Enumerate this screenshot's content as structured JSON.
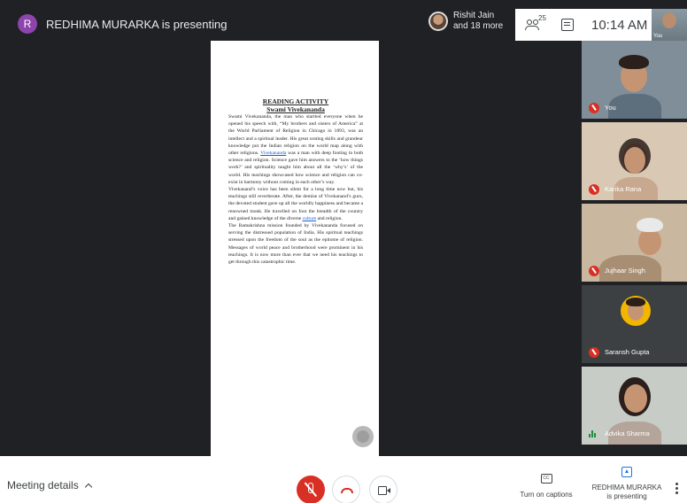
{
  "presenter_bar": {
    "avatar_letter": "R",
    "presenting_text": "REDHIMA MURARKA is presenting"
  },
  "participants": {
    "line1": "Rishit Jain",
    "line2": "and 18 more",
    "count": "25"
  },
  "clock": "10:14 AM",
  "self_label": "You",
  "document": {
    "title": "READING ACTIVITY",
    "subtitle": "Swami Vivekananda",
    "para1_a": "Swami Vivekananda, the man who startled everyone when he opened his speech with, “My brothers and sisters of America” at the World Parliament of Religion in Chicago in 1893, was an intellect and a spiritual leader. His great orating skills and grandeur knowledge put the Indian religion on the world map along with other religions. ",
    "para1_link": "Vivekananda",
    "para1_b": " was a man with deep footing in both science and religion. Science gave him answers to the ‘how things work?’ and spirituality taught him about all the ‘why’s’ of the world. His teachings showcased how science and religion can co-exist in harmony without coming in each other’s way.",
    "para2_a": "Vivekanand’s voice has been silent for a long time now but, his teachings still reverberate. After, the demise of Vivekanand’s guru, the devoted student gave up all the worldly happiness and became a renowned monk. He travelled on foot the breadth of the country and gained knowledge of the diverse ",
    "para2_link": "culture",
    "para2_b": " and religion.",
    "para3": "The Ramakrishna mission founded by Vivekananda focused on serving the distressed population of India. His spiritual teachings stressed upon the freedom of the soul as the epitome of religion. Messages of world peace and brotherhood were prominent in his teachings. It is now more than ever that we need his teachings to get through this catastrophic time."
  },
  "tiles": [
    {
      "name": "You",
      "muted": true
    },
    {
      "name": "Karika Rana",
      "muted": true
    },
    {
      "name": "Jujhaar Singh",
      "muted": true
    },
    {
      "name": "Saransh Gupta",
      "muted": true
    },
    {
      "name": "Advika Sharma",
      "muted": false
    }
  ],
  "bottom_bar": {
    "meeting_details": "Meeting details",
    "captions_icon": "CC",
    "captions_label": "Turn on captions",
    "present_label_line1": "REDHIMA MURARKA",
    "present_label_line2": "is presenting"
  },
  "colors": {
    "stage_bg": "#202124",
    "mute_red": "#d93025",
    "accent_blue": "#1a73e8",
    "speaking_green": "#1e8e3e"
  },
  "icons": [
    "people-icon",
    "chat-icon",
    "mic-off-icon",
    "hang-up-icon",
    "camera-icon",
    "captions-icon",
    "present-icon",
    "more-vert-icon"
  ]
}
